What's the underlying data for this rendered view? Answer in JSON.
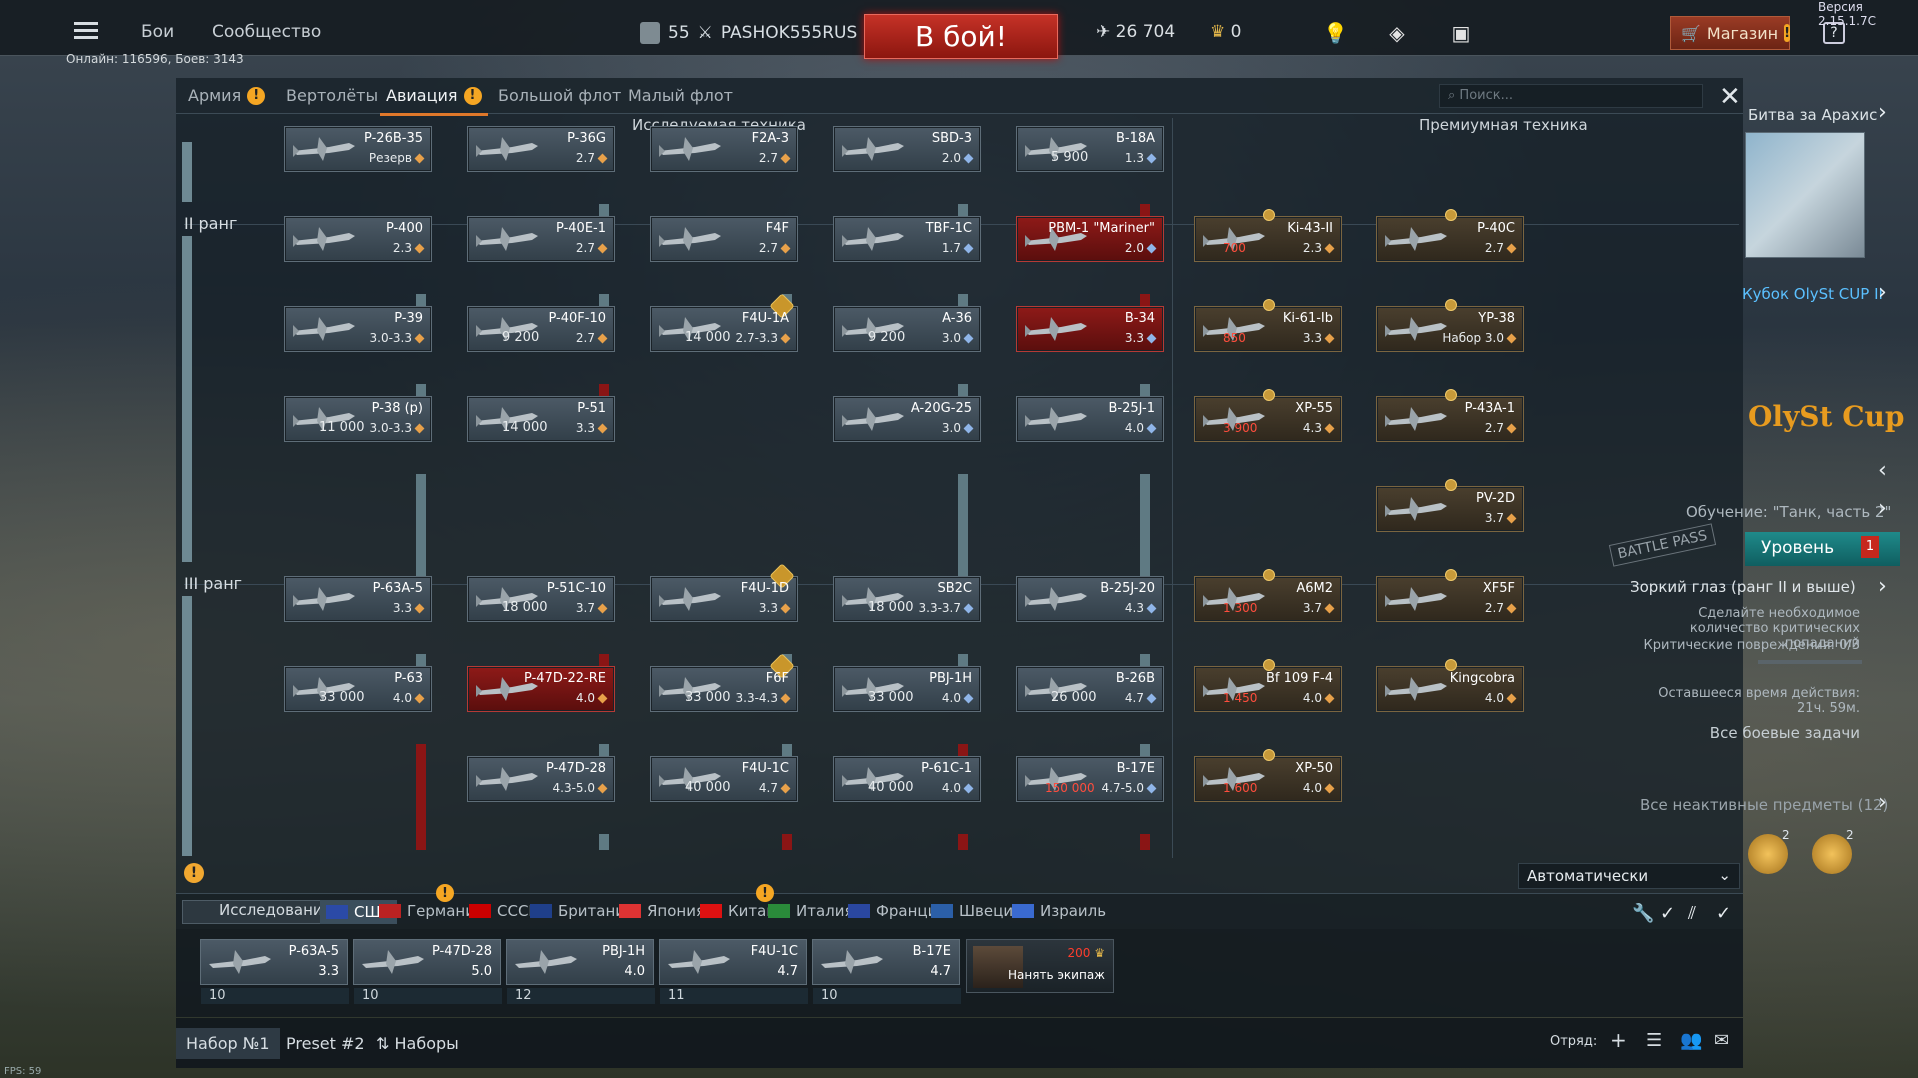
{
  "version": "Версия 2.15.1.7C",
  "online": "Онлайн: 116596, Боев: 3143",
  "topnav": {
    "battles": "Бои",
    "community": "Сообщество",
    "level": "55",
    "nickname": "PASHOK555RUS",
    "battle_button": "В бой!",
    "silver": "26 704",
    "gold": "0",
    "shop": "Магазин",
    "help": "?"
  },
  "tabs": [
    {
      "label": "Армия",
      "warn": true
    },
    {
      "label": "Вертолёты",
      "warn": false
    },
    {
      "label": "Авиация",
      "warn": true,
      "active": true
    },
    {
      "label": "Большой флот",
      "warn": false
    },
    {
      "label": "Малый флот",
      "warn": false
    }
  ],
  "search": {
    "placeholder": "Поиск..."
  },
  "sections": {
    "researched": "Исследуемая техника",
    "premium": "Премиумная техника"
  },
  "ranks": {
    "r2": "II ранг",
    "r3": "III ранг"
  },
  "cards": {
    "c0_0": {
      "name": "P-26B-35",
      "br": "Резерв"
    },
    "c1_0": {
      "name": "P-36G",
      "br": "2.7"
    },
    "c2_0": {
      "name": "F2A-3",
      "br": "2.7"
    },
    "c3_0": {
      "name": "SBD-3",
      "br": "2.0"
    },
    "c4_0": {
      "name": "B-18A",
      "br": "1.3",
      "xp": "5 900"
    },
    "c0_1": {
      "name": "P-400",
      "br": "2.3"
    },
    "c1_1": {
      "name": "P-40E-1",
      "br": "2.7"
    },
    "c2_1": {
      "name": "F4F",
      "br": "2.7"
    },
    "c3_1": {
      "name": "TBF-1C",
      "br": "1.7"
    },
    "c4_1": {
      "name": "PBM-1 \"Mariner\"",
      "br": "2.0"
    },
    "c0_2": {
      "name": "P-39",
      "br": "3.0-3.3"
    },
    "c1_2": {
      "name": "P-40F-10",
      "br": "2.7",
      "xp": "9 200"
    },
    "c2_2": {
      "name": "F4U-1A",
      "br": "2.7-3.3",
      "xp": "14 000"
    },
    "c3_2": {
      "name": "A-36",
      "br": "3.0",
      "xp": "9 200"
    },
    "c4_2": {
      "name": "B-34",
      "br": "3.3"
    },
    "c0_3": {
      "name": "P-38 (p)",
      "br": "3.0-3.3",
      "xp": "11 000"
    },
    "c1_3": {
      "name": "P-51",
      "br": "3.3",
      "xp": "14 000"
    },
    "c3_3": {
      "name": "A-20G-25",
      "br": "3.0"
    },
    "c4_3": {
      "name": "B-25J-1",
      "br": "4.0"
    },
    "c0_4": {
      "name": "P-63A-5",
      "br": "3.3"
    },
    "c1_4": {
      "name": "P-51C-10",
      "br": "3.7",
      "xp": "18 000"
    },
    "c2_4": {
      "name": "F4U-1D",
      "br": "3.3"
    },
    "c3_4": {
      "name": "SB2C",
      "br": "3.3-3.7",
      "xp": "18 000"
    },
    "c4_4": {
      "name": "B-25J-20",
      "br": "4.3"
    },
    "c0_5": {
      "name": "P-63",
      "br": "4.0",
      "xp": "33 000"
    },
    "c1_5": {
      "name": "P-47D-22-RE",
      "br": "4.0"
    },
    "c2_5": {
      "name": "F6F",
      "br": "3.3-4.3",
      "xp": "33 000"
    },
    "c3_5": {
      "name": "PBJ-1H",
      "br": "4.0",
      "xp": "33 000"
    },
    "c4_5": {
      "name": "B-26B",
      "br": "4.7",
      "xp": "26 000"
    },
    "c1_6": {
      "name": "P-47D-28",
      "br": "4.3-5.0"
    },
    "c2_6": {
      "name": "F4U-1C",
      "br": "4.7",
      "xp": "40 000"
    },
    "c3_6": {
      "name": "P-61C-1",
      "br": "4.0",
      "xp": "40 000"
    },
    "c4_6": {
      "name": "B-17E",
      "br": "4.7-5.0",
      "gold": "150 000"
    },
    "p0_1": {
      "name": "Ki-43-II",
      "br": "2.3",
      "gold": "700"
    },
    "p1_1": {
      "name": "P-40C",
      "br": "2.7"
    },
    "p0_2": {
      "name": "Ki-61-Ib",
      "br": "3.3",
      "gold": "850"
    },
    "p1_2": {
      "name": "YP-38",
      "br": "Набор 3.0"
    },
    "p0_3": {
      "name": "XP-55",
      "br": "4.3",
      "gold": "3 900"
    },
    "p1_3": {
      "name": "P-43A-1",
      "br": "2.7"
    },
    "p1_35": {
      "name": "PV-2D",
      "br": "3.7"
    },
    "p0_4": {
      "name": "A6M2",
      "br": "3.7",
      "gold": "1 300"
    },
    "p1_4": {
      "name": "XF5F",
      "br": "2.7"
    },
    "p0_5": {
      "name": "Bf 109 F-4",
      "br": "4.0",
      "gold": "1 450"
    },
    "p1_5": {
      "name": "Kingcobra",
      "br": "4.0"
    },
    "p0_6": {
      "name": "XP-50",
      "br": "4.0",
      "gold": "1 600"
    }
  },
  "side": {
    "event1": "Битва за Арахис",
    "event2": "Кубок OlySt CUP II",
    "brand": "OlySt Cup",
    "tutorial": "Обучение: \"Танк, часть 2\"",
    "level": "Уровень",
    "level_badge": "1",
    "task": "Зоркий глаз (ранг II и выше)",
    "task_desc": "Сделайте необходимое количество критических попаданий",
    "task_progress": "Критические повреждения: 0/3",
    "time_left": "Оставшееся время действия: 21ч. 59м.",
    "all_tasks": "Все боевые задачи",
    "inactive": "Все неактивные предметы (12)",
    "battlepass": "BATTLE PASS",
    "item1": "2",
    "item2": "2"
  },
  "auto": "Автоматически",
  "research": "Исследования",
  "nations": [
    {
      "label": "США",
      "active": true,
      "c": "#2b4aa6"
    },
    {
      "label": "Германия",
      "c": "#b22"
    },
    {
      "label": "СССР",
      "c": "#c00"
    },
    {
      "label": "Британия",
      "c": "#1f3f8a"
    },
    {
      "label": "Япония",
      "c": "#d33"
    },
    {
      "label": "Китай",
      "c": "#d11"
    },
    {
      "label": "Италия",
      "c": "#2a8a3a"
    },
    {
      "label": "Франция",
      "c": "#2a47a0"
    },
    {
      "label": "Швеция",
      "c": "#2b5fa8"
    },
    {
      "label": "Израиль",
      "c": "#3a6ad0"
    }
  ],
  "crew": [
    {
      "name": "P-63A-5",
      "br": "3.3",
      "num": "10"
    },
    {
      "name": "P-47D-28",
      "br": "5.0",
      "num": "10"
    },
    {
      "name": "PBJ-1H",
      "br": "4.0",
      "num": "12"
    },
    {
      "name": "F4U-1C",
      "br": "4.7",
      "num": "11"
    },
    {
      "name": "B-17E",
      "br": "4.7",
      "num": "10"
    }
  ],
  "hire": {
    "price": "200",
    "label": "Нанять экипаж"
  },
  "presets": {
    "p1": "Набор №1",
    "p2": "Preset #2",
    "p3": "Наборы",
    "squad": "Отряд:"
  },
  "fps": "FPS: 59"
}
